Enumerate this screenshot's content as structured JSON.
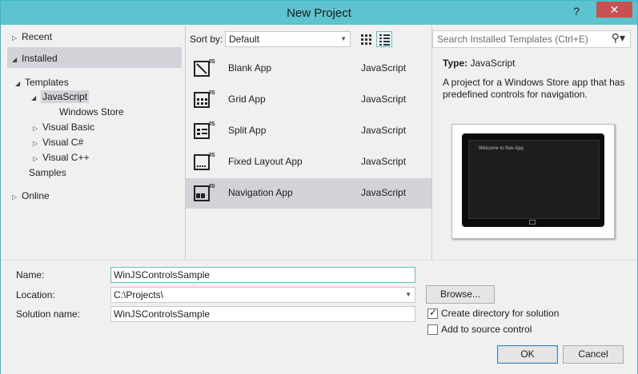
{
  "window": {
    "title": "New Project",
    "help": "?",
    "close": "✕"
  },
  "left_pane": {
    "recent": "Recent",
    "installed": "Installed",
    "templates": "Templates",
    "javascript": "JavaScript",
    "windows_store": "Windows Store",
    "visual_basic": "Visual Basic",
    "visual_csharp": "Visual C#",
    "visual_cpp": "Visual C++",
    "samples": "Samples",
    "online": "Online"
  },
  "sortbar": {
    "label": "Sort by:",
    "value": "Default"
  },
  "search": {
    "placeholder": "Search Installed Templates (Ctrl+E)"
  },
  "templates": [
    {
      "name": "Blank App",
      "lang": "JavaScript"
    },
    {
      "name": "Grid App",
      "lang": "JavaScript"
    },
    {
      "name": "Split App",
      "lang": "JavaScript"
    },
    {
      "name": "Fixed Layout App",
      "lang": "JavaScript"
    },
    {
      "name": "Navigation App",
      "lang": "JavaScript"
    }
  ],
  "details": {
    "type_label": "Type:",
    "type_value": "JavaScript",
    "description": "A project for a Windows Store app that has predefined controls for navigation.",
    "preview_text": "Welcome to Nav App"
  },
  "form": {
    "name_label": "Name:",
    "name_value": "WinJSControlsSample",
    "location_label": "Location:",
    "location_value": "C:\\Projects\\",
    "solution_label": "Solution name:",
    "solution_value": "WinJSControlsSample",
    "browse": "Browse...",
    "create_dir": "Create directory for solution",
    "source_control": "Add to source control",
    "ok": "OK",
    "cancel": "Cancel"
  },
  "colors": {
    "titlebar": "#5cc3cf",
    "selection": "#d2d2d8",
    "close": "#c75050"
  }
}
